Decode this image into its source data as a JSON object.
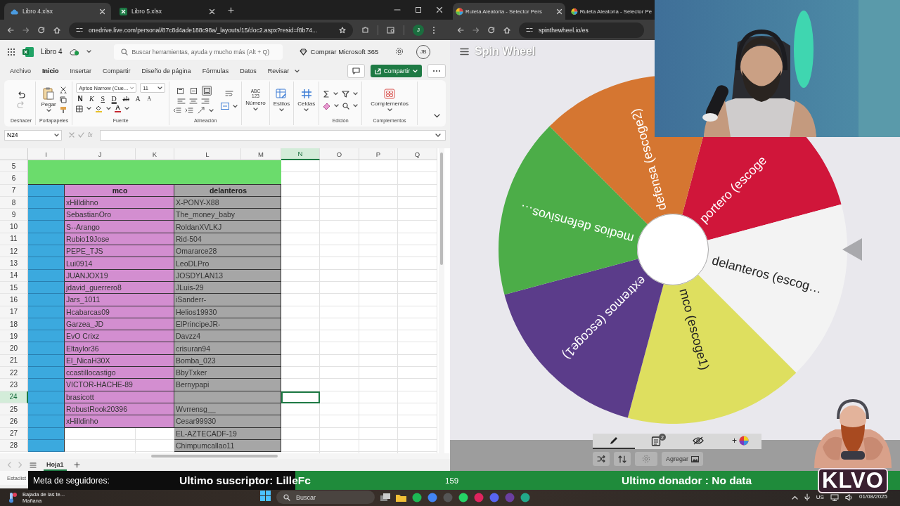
{
  "left_browser": {
    "tabs": [
      {
        "title": "Libro 4.xlsx",
        "kind": "cloud",
        "selected": true
      },
      {
        "title": "Libro 5.xlsx",
        "kind": "excel",
        "selected": false
      }
    ],
    "url": "onedrive.live.com/personal/87c8d4ade188c98a/_layouts/15/doc2.aspx?resid=f8b74...",
    "profile": "J"
  },
  "excel": {
    "file_name": "Libro 4",
    "search_placeholder": "Buscar herramientas, ayuda y mucho más (Alt + Q)",
    "buy": "Comprar Microsoft 365",
    "avatar": "JB",
    "menu": [
      {
        "label": "Archivo",
        "selected": false
      },
      {
        "label": "Inicio",
        "selected": true
      },
      {
        "label": "Insertar",
        "selected": false
      },
      {
        "label": "Compartir",
        "selected": false
      },
      {
        "label": "Diseño de página",
        "selected": false
      },
      {
        "label": "Fórmulas",
        "selected": false
      },
      {
        "label": "Datos",
        "selected": false
      },
      {
        "label": "Revisar",
        "selected": false
      }
    ],
    "share": "Compartir",
    "ribbon": {
      "undo_group": "Deshacer",
      "paste": "Pegar",
      "clipboard_group": "Portapapeles",
      "font_name": "Aptos Narrow (Cue...",
      "font_size": "11",
      "format_buttons": [
        {
          "label": "N",
          "kind": "bold"
        },
        {
          "label": "K",
          "kind": "italic"
        },
        {
          "label": "S",
          "kind": "underline"
        },
        {
          "label": "D",
          "kind": "double_underline"
        },
        {
          "label": "ab",
          "kind": "strike"
        },
        {
          "label": "A",
          "kind": "grow"
        },
        {
          "label": "A",
          "kind": "shrink"
        }
      ],
      "font_color": "A",
      "font_group": "Fuente",
      "vertical_align": [
        {
          "kind": "top",
          "selected": false
        },
        {
          "kind": "middle",
          "selected": false
        },
        {
          "kind": "bottom",
          "selected": true
        }
      ],
      "align_group": "Alineación",
      "number_glyph": [
        "ABC",
        "123"
      ],
      "number": "Número",
      "styles": "Estilos",
      "cells": "Celdas",
      "edit_group": "Edición",
      "addins": "Complementos",
      "addins_group": "Complementos"
    },
    "name_box": "N24",
    "fx": "fx",
    "sheet": {
      "columns": [
        {
          "label": "I",
          "selected": false
        },
        {
          "label": "J",
          "selected": false
        },
        {
          "label": "K",
          "selected": false
        },
        {
          "label": "L",
          "selected": false
        },
        {
          "label": "M",
          "selected": false
        },
        {
          "label": "N",
          "selected": true
        },
        {
          "label": "O",
          "selected": false
        },
        {
          "label": "P",
          "selected": false
        },
        {
          "label": "Q",
          "selected": false
        }
      ],
      "rows": [
        {
          "number": "5",
          "kind": "banner",
          "selected": false
        },
        {
          "number": "6",
          "kind": "banner",
          "selected": false
        },
        {
          "number": "7",
          "kind": "header",
          "selected": false,
          "col_j": "mco",
          "col_l": "delanteros"
        },
        {
          "number": "8",
          "kind": "data",
          "selected": false,
          "col_j": "xHilldihno",
          "col_l": "X-PONY-X88"
        },
        {
          "number": "9",
          "kind": "data",
          "selected": false,
          "col_j": "SebastianOro",
          "col_l": "The_money_baby"
        },
        {
          "number": "10",
          "kind": "data",
          "selected": false,
          "col_j": "S--Arango",
          "col_l": "RoldanXVLKJ"
        },
        {
          "number": "11",
          "kind": "data",
          "selected": false,
          "col_j": "Rubio19Jose",
          "col_l": "Rid-504"
        },
        {
          "number": "12",
          "kind": "data",
          "selected": false,
          "col_j": "PEPE_TJS",
          "col_l": "Omararce28"
        },
        {
          "number": "13",
          "kind": "data",
          "selected": false,
          "col_j": "Lui0914",
          "col_l": "LeoDLPro"
        },
        {
          "number": "14",
          "kind": "data",
          "selected": false,
          "col_j": "JUANJOX19",
          "col_l": "JOSDYLAN13"
        },
        {
          "number": "15",
          "kind": "data",
          "selected": false,
          "col_j": "jdavid_guerrero8",
          "col_l": "JLuis-29"
        },
        {
          "number": "16",
          "kind": "data",
          "selected": false,
          "col_j": "Jars_1011",
          "col_l": "iSanderr-"
        },
        {
          "number": "17",
          "kind": "data",
          "selected": false,
          "col_j": "Hcabarcas09",
          "col_l": "Helios19930"
        },
        {
          "number": "18",
          "kind": "data",
          "selected": false,
          "col_j": "Garzea_JD",
          "col_l": "ElPrincipeJR-"
        },
        {
          "number": "19",
          "kind": "data",
          "selected": false,
          "col_j": "EvO Crixz",
          "col_l": "Davzz4"
        },
        {
          "number": "20",
          "kind": "data",
          "selected": false,
          "col_j": "Eltaylor36",
          "col_l": "crisuran94"
        },
        {
          "number": "21",
          "kind": "data",
          "selected": false,
          "col_j": "El_NicaH30X",
          "col_l": "Bomba_023"
        },
        {
          "number": "22",
          "kind": "data",
          "selected": false,
          "col_j": "ccastillocastigo",
          "col_l": "BbyTxker"
        },
        {
          "number": "23",
          "kind": "data",
          "selected": false,
          "col_j": "VICTOR-HACHE-89",
          "col_l": "Bernypapi"
        },
        {
          "number": "24",
          "kind": "data",
          "selected": true,
          "col_j": "brasicott"
        },
        {
          "number": "25",
          "kind": "data",
          "selected": false,
          "col_j": "RobustRook20396",
          "col_l": "Wvrrensg__"
        },
        {
          "number": "26",
          "kind": "data",
          "selected": false,
          "col_j": "xHilldinho",
          "col_l": "Cesar99930"
        },
        {
          "number": "27",
          "kind": "tail",
          "selected": false,
          "col_l": "EL-AZTECADF-19"
        },
        {
          "number": "28",
          "kind": "tail",
          "selected": false,
          "col_l": "Chimpumcallao11"
        }
      ]
    },
    "sheet_tabs": [
      {
        "label": "Hoja1",
        "selected": true
      }
    ],
    "status": "Estadíst"
  },
  "right_browser": {
    "tabs": [
      {
        "title": "Ruleta Aleatoria - Selector Pers",
        "selected": true
      },
      {
        "title": "Ruleta Aleatoria - Selector Pe",
        "selected": false
      }
    ],
    "url": "spinthewheel.io/es"
  },
  "wheel_app": {
    "logo": "Spin Wheel",
    "segments": [
      {
        "label": "portero (escoge",
        "color": "#d0163a"
      },
      {
        "label": "delanteros (escog…",
        "color": "#f3f3f3"
      },
      {
        "label": "mco (escoge1)",
        "color": "#dedf5f"
      },
      {
        "label": "extremos (escoge1)",
        "color": "#5b3c8a"
      },
      {
        "label": "medios defensivos…",
        "color": "#4cad48"
      },
      {
        "label": "defensa (escoge2)",
        "color": "#d57631"
      }
    ],
    "toolbar_tabs": [
      {
        "kind": "edit",
        "selected": true
      },
      {
        "kind": "list",
        "selected": false,
        "badge": "2"
      },
      {
        "kind": "hide",
        "selected": false
      },
      {
        "kind": "color",
        "selected": false,
        "label": "+"
      }
    ],
    "add_button": "Agregar"
  },
  "stream_overlay": {
    "followers_goal": "Meta de seguidores:",
    "last_subscriber": "Ultimo suscriptor: LilleFc",
    "count": "159",
    "last_donor": "Ultimo donador : No data",
    "logo": "KLVO"
  },
  "taskbar": {
    "weather": "Bajada de las te...",
    "weather_sub": "Mañana",
    "search": "Buscar",
    "keyboard": "US",
    "date": "01/08/2025"
  }
}
